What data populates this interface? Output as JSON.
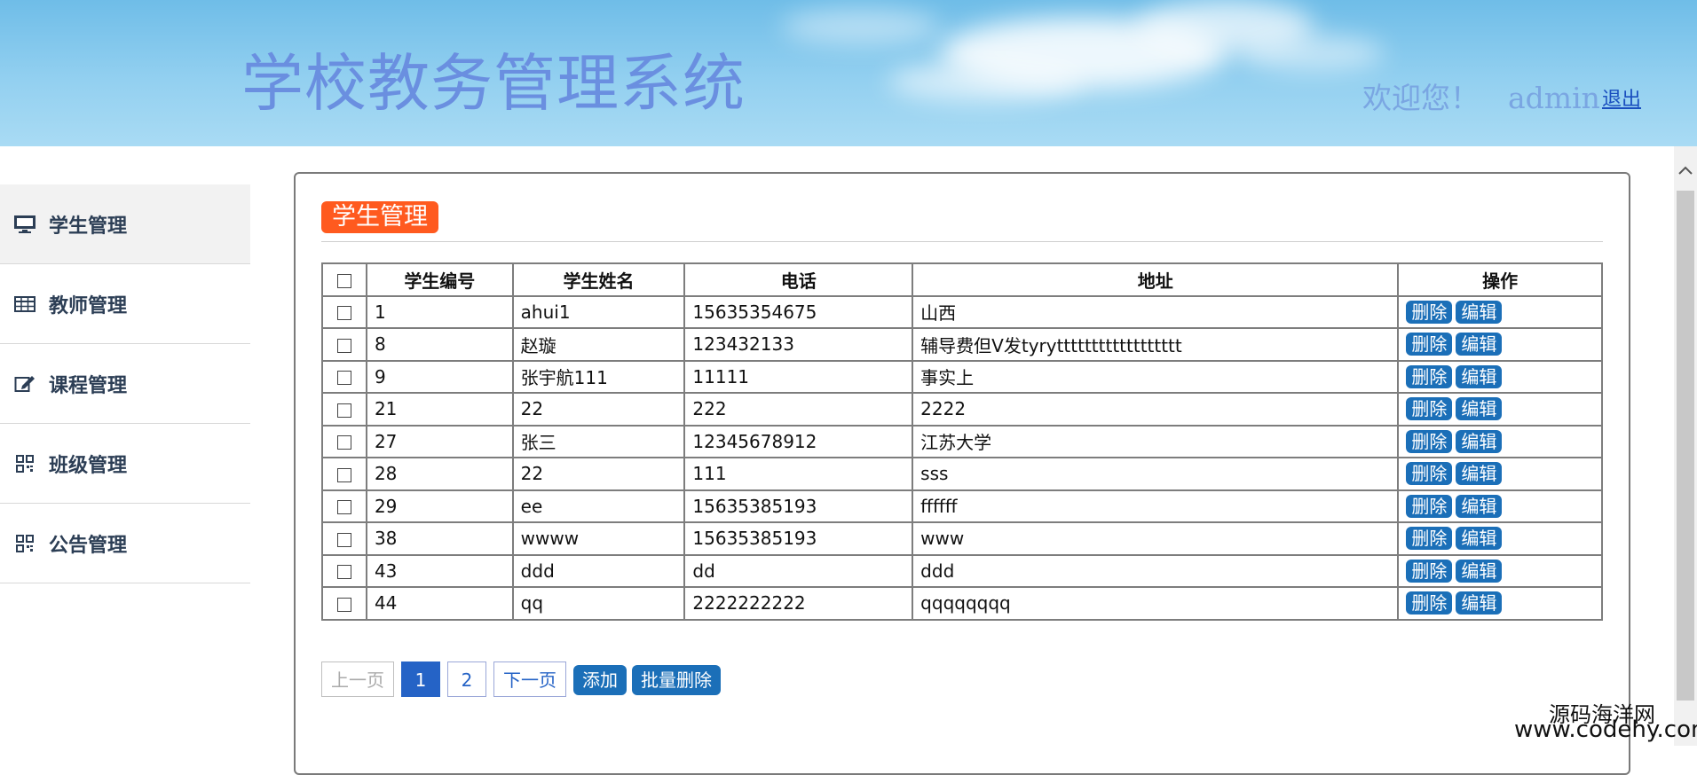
{
  "header": {
    "title": "学校教务管理系统",
    "welcome": "欢迎您！",
    "username": "admin",
    "logout": "退出"
  },
  "sidebar": {
    "items": [
      {
        "label": "学生管理",
        "icon": "monitor-icon",
        "active": true
      },
      {
        "label": "教师管理",
        "icon": "table-icon",
        "active": false
      },
      {
        "label": "课程管理",
        "icon": "edit-icon",
        "active": false
      },
      {
        "label": "班级管理",
        "icon": "qrcode-icon",
        "active": false
      },
      {
        "label": "公告管理",
        "icon": "qrcode-icon",
        "active": false
      }
    ]
  },
  "panel": {
    "title": "学生管理"
  },
  "table": {
    "columns": [
      "学生编号",
      "学生姓名",
      "电话",
      "地址",
      "操作"
    ],
    "delete_label": "删除",
    "edit_label": "编辑",
    "rows": [
      {
        "id": "1",
        "name": "ahui1",
        "phone": "15635354675",
        "address": "山西"
      },
      {
        "id": "8",
        "name": "赵璇",
        "phone": "123432133",
        "address": "辅导费但V发tyrytttttttttttttttttt"
      },
      {
        "id": "9",
        "name": "张宇航111",
        "phone": "11111",
        "address": "事实上"
      },
      {
        "id": "21",
        "name": "22",
        "phone": "222",
        "address": "2222"
      },
      {
        "id": "27",
        "name": "张三",
        "phone": "12345678912",
        "address": "江苏大学"
      },
      {
        "id": "28",
        "name": "22",
        "phone": "111",
        "address": "sss"
      },
      {
        "id": "29",
        "name": "ee",
        "phone": "15635385193",
        "address": "ffffff"
      },
      {
        "id": "38",
        "name": "wwww",
        "phone": "15635385193",
        "address": "www"
      },
      {
        "id": "43",
        "name": "ddd",
        "phone": "dd",
        "address": "ddd"
      },
      {
        "id": "44",
        "name": "qq",
        "phone": "2222222222",
        "address": "qqqqqqqq"
      }
    ]
  },
  "pager": {
    "prev": "上一页",
    "pages": [
      "1",
      "2"
    ],
    "current": "1",
    "next": "下一页",
    "add": "添加",
    "batch_delete": "批量删除"
  },
  "watermark": {
    "line1": "源码海洋网",
    "line2": "www.codehy.com"
  },
  "colors": {
    "accent": "#1b6fb8",
    "tag": "#ff5a1f",
    "title": "#6a8fe0"
  }
}
